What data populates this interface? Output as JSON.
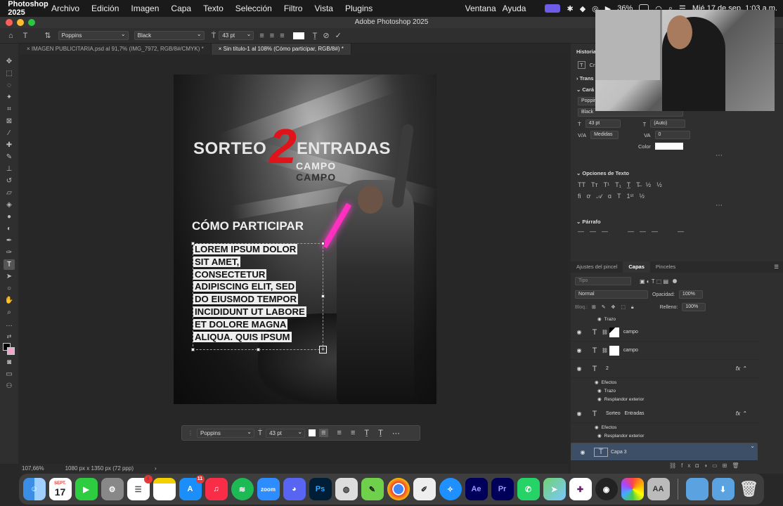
{
  "menubar": {
    "app_name": "Photoshop 2025",
    "items": [
      "Archivo",
      "Edición",
      "Imagen",
      "Capa",
      "Texto",
      "Selección",
      "Filtro",
      "Vista",
      "Plugins"
    ],
    "right_items": [
      "Ventana",
      "Ayuda"
    ],
    "battery": "36%",
    "clock": "Mié 17 de sep.  1:03 a.m."
  },
  "window": {
    "title": "Adobe Photoshop 2025"
  },
  "options_bar": {
    "font_family": "Poppins",
    "font_style": "Black",
    "font_size": "43 pt"
  },
  "tabs": [
    {
      "label": "IMAGEN PUBLICITARIA.psd al 91,7% (IMG_7972, RGB/8#/CMYK) *",
      "active": false
    },
    {
      "label": "Sin título-1 al 108% (Cómo participar, RGB/8#) *",
      "active": true
    }
  ],
  "canvas": {
    "sorteo": "SORTEO",
    "number": "2",
    "entradas": "ENTRADAS",
    "campo": "CAMPO",
    "campo_shadow": "CAMPO",
    "como_participar": "CÓMO PARTICIPAR",
    "lorem_lines": [
      "LOREM IPSUM DOLOR",
      "SIT AMET,",
      "CONSECTETUR",
      "ADIPISCING ELIT, SED",
      "DO EIUSMOD TEMPOR",
      "INCIDIDUNT UT LABORE",
      "ET DOLORE MAGNA",
      "ALIQUA. QUIS IPSUM"
    ]
  },
  "floating_bar": {
    "font_family": "Poppins",
    "font_size": "43 pt"
  },
  "status": {
    "zoom": "107,66%",
    "doc_size": "1080 px x 1350 px (72 ppp)"
  },
  "panels": {
    "historia": "Historia",
    "transform": "Trans",
    "caracter": "Cará",
    "font_family": "Poppins",
    "font_style": "Black",
    "size": "43 pt",
    "leading": "(Auto)",
    "kerning": "Medidas",
    "tracking": "0",
    "color_label": "Color",
    "opciones_texto": "Opciones de Texto",
    "parrafo": "Párrafo",
    "tabs": [
      "Ajustes del pincel",
      "Capas",
      "Pinceles"
    ],
    "search_placeholder": "Tipo",
    "blend_mode": "Normal",
    "opacity_label": "Opacidad:",
    "opacity": "100%",
    "fill_label": "Relleno:",
    "fill": "100%",
    "lock_label": "Bloq.:"
  },
  "layers": [
    {
      "kind": "sub",
      "name": "Trazo"
    },
    {
      "kind": "layer",
      "name": "campo",
      "thumb": true,
      "fx": false
    },
    {
      "kind": "layer",
      "name": "campo",
      "thumb": true,
      "fx": false
    },
    {
      "kind": "layer",
      "name": "2",
      "thumb": false,
      "fx": true
    },
    {
      "kind": "sub",
      "name": "Efectos"
    },
    {
      "kind": "sub",
      "name": "Trazo"
    },
    {
      "kind": "sub",
      "name": "Resplandor exterior"
    },
    {
      "kind": "layer",
      "name": "Sorteo   Entradas",
      "thumb": false,
      "fx": true
    },
    {
      "kind": "sub",
      "name": "Efectos"
    },
    {
      "kind": "sub",
      "name": "Resplandor exterior"
    },
    {
      "kind": "layer",
      "name": "Capa 3",
      "thumb": false,
      "fx": false,
      "selected": true
    }
  ],
  "dock": {
    "calendar_month": "SEPT.",
    "calendar_day": "17",
    "reminders_badge": "4",
    "appstore_badge": "11",
    "labels": {
      "zoom": "zoom",
      "ps": "Ps",
      "ae": "Ae",
      "pr": "Pr"
    }
  },
  "colors": {
    "accent_selected_layer": "#3c4f66",
    "two_red": "#e0131b",
    "neon": "#ff2fbf"
  }
}
